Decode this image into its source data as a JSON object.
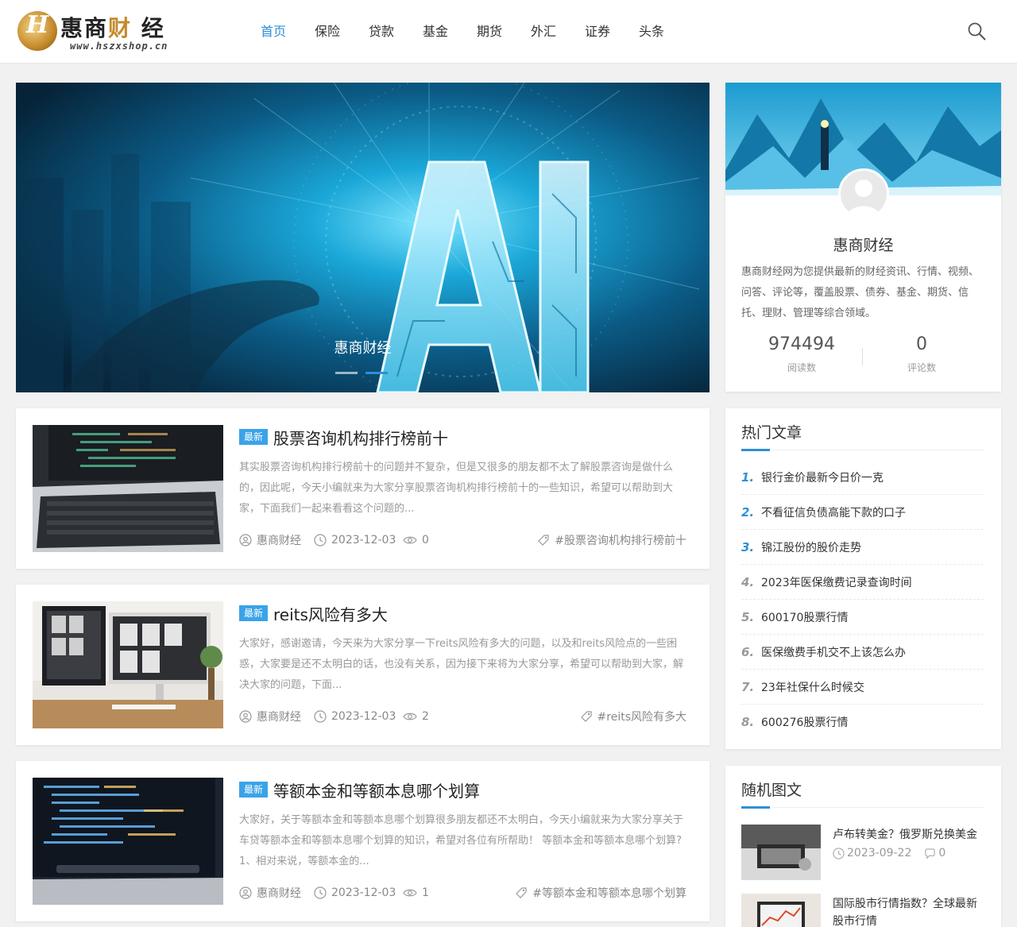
{
  "site": {
    "logo_letter": "H",
    "logo_name_a": "惠商",
    "logo_name_b": "财",
    "logo_name_c": "经",
    "logo_domain": "www.hszxshop.cn"
  },
  "nav": [
    "首页",
    "保险",
    "贷款",
    "基金",
    "期货",
    "外汇",
    "证券",
    "头条"
  ],
  "banner": {
    "caption": "惠商财经",
    "slides": 2,
    "active_slide": 1
  },
  "profile": {
    "name": "惠商财经",
    "description": "惠商财经网为您提供最新的财经资讯、行情、视频、问答、评论等，覆盖股票、债券、基金、期货、信托、理财、管理等综合领域。",
    "reads_value": "974494",
    "reads_label": "阅读数",
    "comments_value": "0",
    "comments_label": "评论数"
  },
  "articles": [
    {
      "badge": "最新",
      "title": "股票咨询机构排行榜前十",
      "excerpt": "其实股票咨询机构排行榜前十的问题并不复杂，但是又很多的朋友都不太了解股票咨询是做什么的，因此呢，今天小编就来为大家分享股票咨询机构排行榜前十的一些知识，希望可以帮助到大家，下面我们一起来看看这个问题的...",
      "author": "惠商财经",
      "date": "2023-12-03",
      "views": "0",
      "tag": "#股票咨询机构排行榜前十"
    },
    {
      "badge": "最新",
      "title": "reits风险有多大",
      "excerpt": "大家好，感谢邀请，今天来为大家分享一下reits风险有多大的问题，以及和reits风险点的一些困惑，大家要是还不太明白的话，也没有关系，因为接下来将为大家分享，希望可以帮助到大家，解决大家的问题，下面...",
      "author": "惠商财经",
      "date": "2023-12-03",
      "views": "2",
      "tag": "#reits风险有多大"
    },
    {
      "badge": "最新",
      "title": "等额本金和等额本息哪个划算",
      "excerpt": "大家好，关于等额本金和等额本息哪个划算很多朋友都还不太明白，今天小编就来为大家分享关于车贷等额本金和等额本息哪个划算的知识，希望对各位有所帮助！ 等额本金和等额本息哪个划算? 1、相对来说，等额本金的...",
      "author": "惠商财经",
      "date": "2023-12-03",
      "views": "1",
      "tag": "#等额本金和等额本息哪个划算"
    }
  ],
  "hot": {
    "title": "热门文章",
    "items": [
      {
        "num": "1.",
        "text": "银行金价最新今日价一克"
      },
      {
        "num": "2.",
        "text": "不看征信负债高能下款的口子"
      },
      {
        "num": "3.",
        "text": "锦江股份的股价走势"
      },
      {
        "num": "4.",
        "text": "2023年医保缴费记录查询时间"
      },
      {
        "num": "5.",
        "text": "600170股票行情"
      },
      {
        "num": "6.",
        "text": "医保缴费手机交不上该怎么办"
      },
      {
        "num": "7.",
        "text": "23年社保什么时候交"
      },
      {
        "num": "8.",
        "text": "600276股票行情"
      }
    ]
  },
  "random": {
    "title": "随机图文",
    "items": [
      {
        "title": "卢布转美金？俄罗斯兑换美金",
        "date": "2023-09-22",
        "comments": "0"
      },
      {
        "title": "国际股市行情指数？全球最新股市行情",
        "date": "",
        "comments": ""
      }
    ]
  },
  "colors": {
    "accent": "#2e8fd4",
    "badge": "#3aa3e8"
  }
}
